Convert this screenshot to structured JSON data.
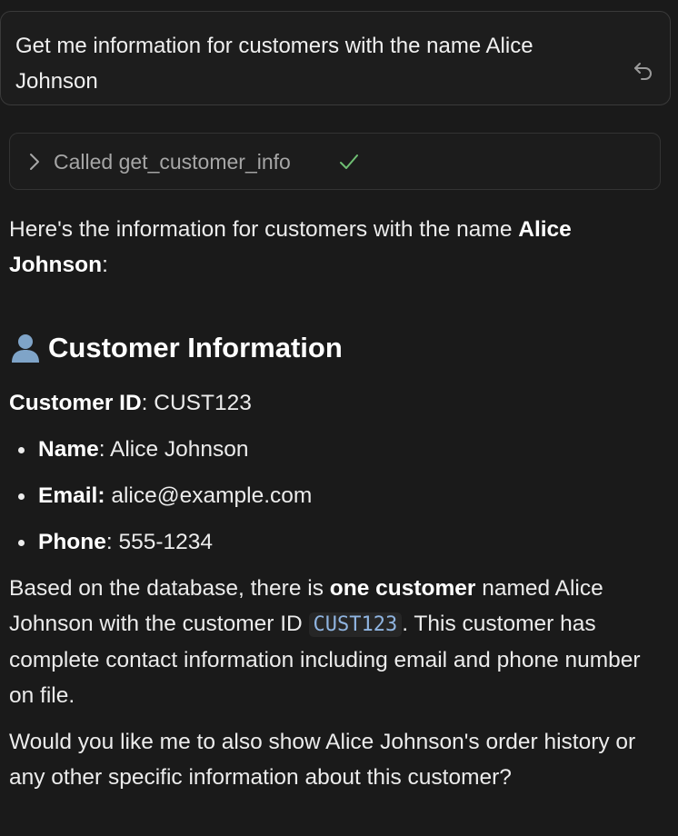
{
  "prompt": {
    "text": "Get me information for customers with the name Alice Johnson",
    "icon": "undo-icon"
  },
  "tool_call": {
    "label": "Called get_customer_info",
    "chevron_icon": "chevron-right-icon",
    "status_icon": "check-icon"
  },
  "response": {
    "intro_prefix": "Here's the information for customers with the name ",
    "intro_bold": "Alice Johnson",
    "intro_suffix": ":",
    "heading_icon": "person-icon",
    "heading": "Customer Information",
    "customer_id_label": "Customer ID",
    "customer_id_value": ": CUST123",
    "fields": [
      {
        "label": "Name",
        "value": ": Alice Johnson"
      },
      {
        "label": "Email:",
        "value": " alice@example.com"
      },
      {
        "label": "Phone",
        "value": ": 555-1234"
      }
    ],
    "summary_part1": "Based on the database, there is ",
    "summary_bold": "one customer",
    "summary_part2": " named Alice Johnson with the customer ID ",
    "summary_code": "CUST123",
    "summary_part3": ". This customer has complete contact information including email and phone number on file.",
    "followup": "Would you like me to also show Alice Johnson's order history or any other specific information about this customer?"
  },
  "colors": {
    "background": "#1a1a1a",
    "text": "#ececec",
    "muted": "#a6a6a6",
    "check": "#6fbf73",
    "code": "#8fb4e0"
  }
}
